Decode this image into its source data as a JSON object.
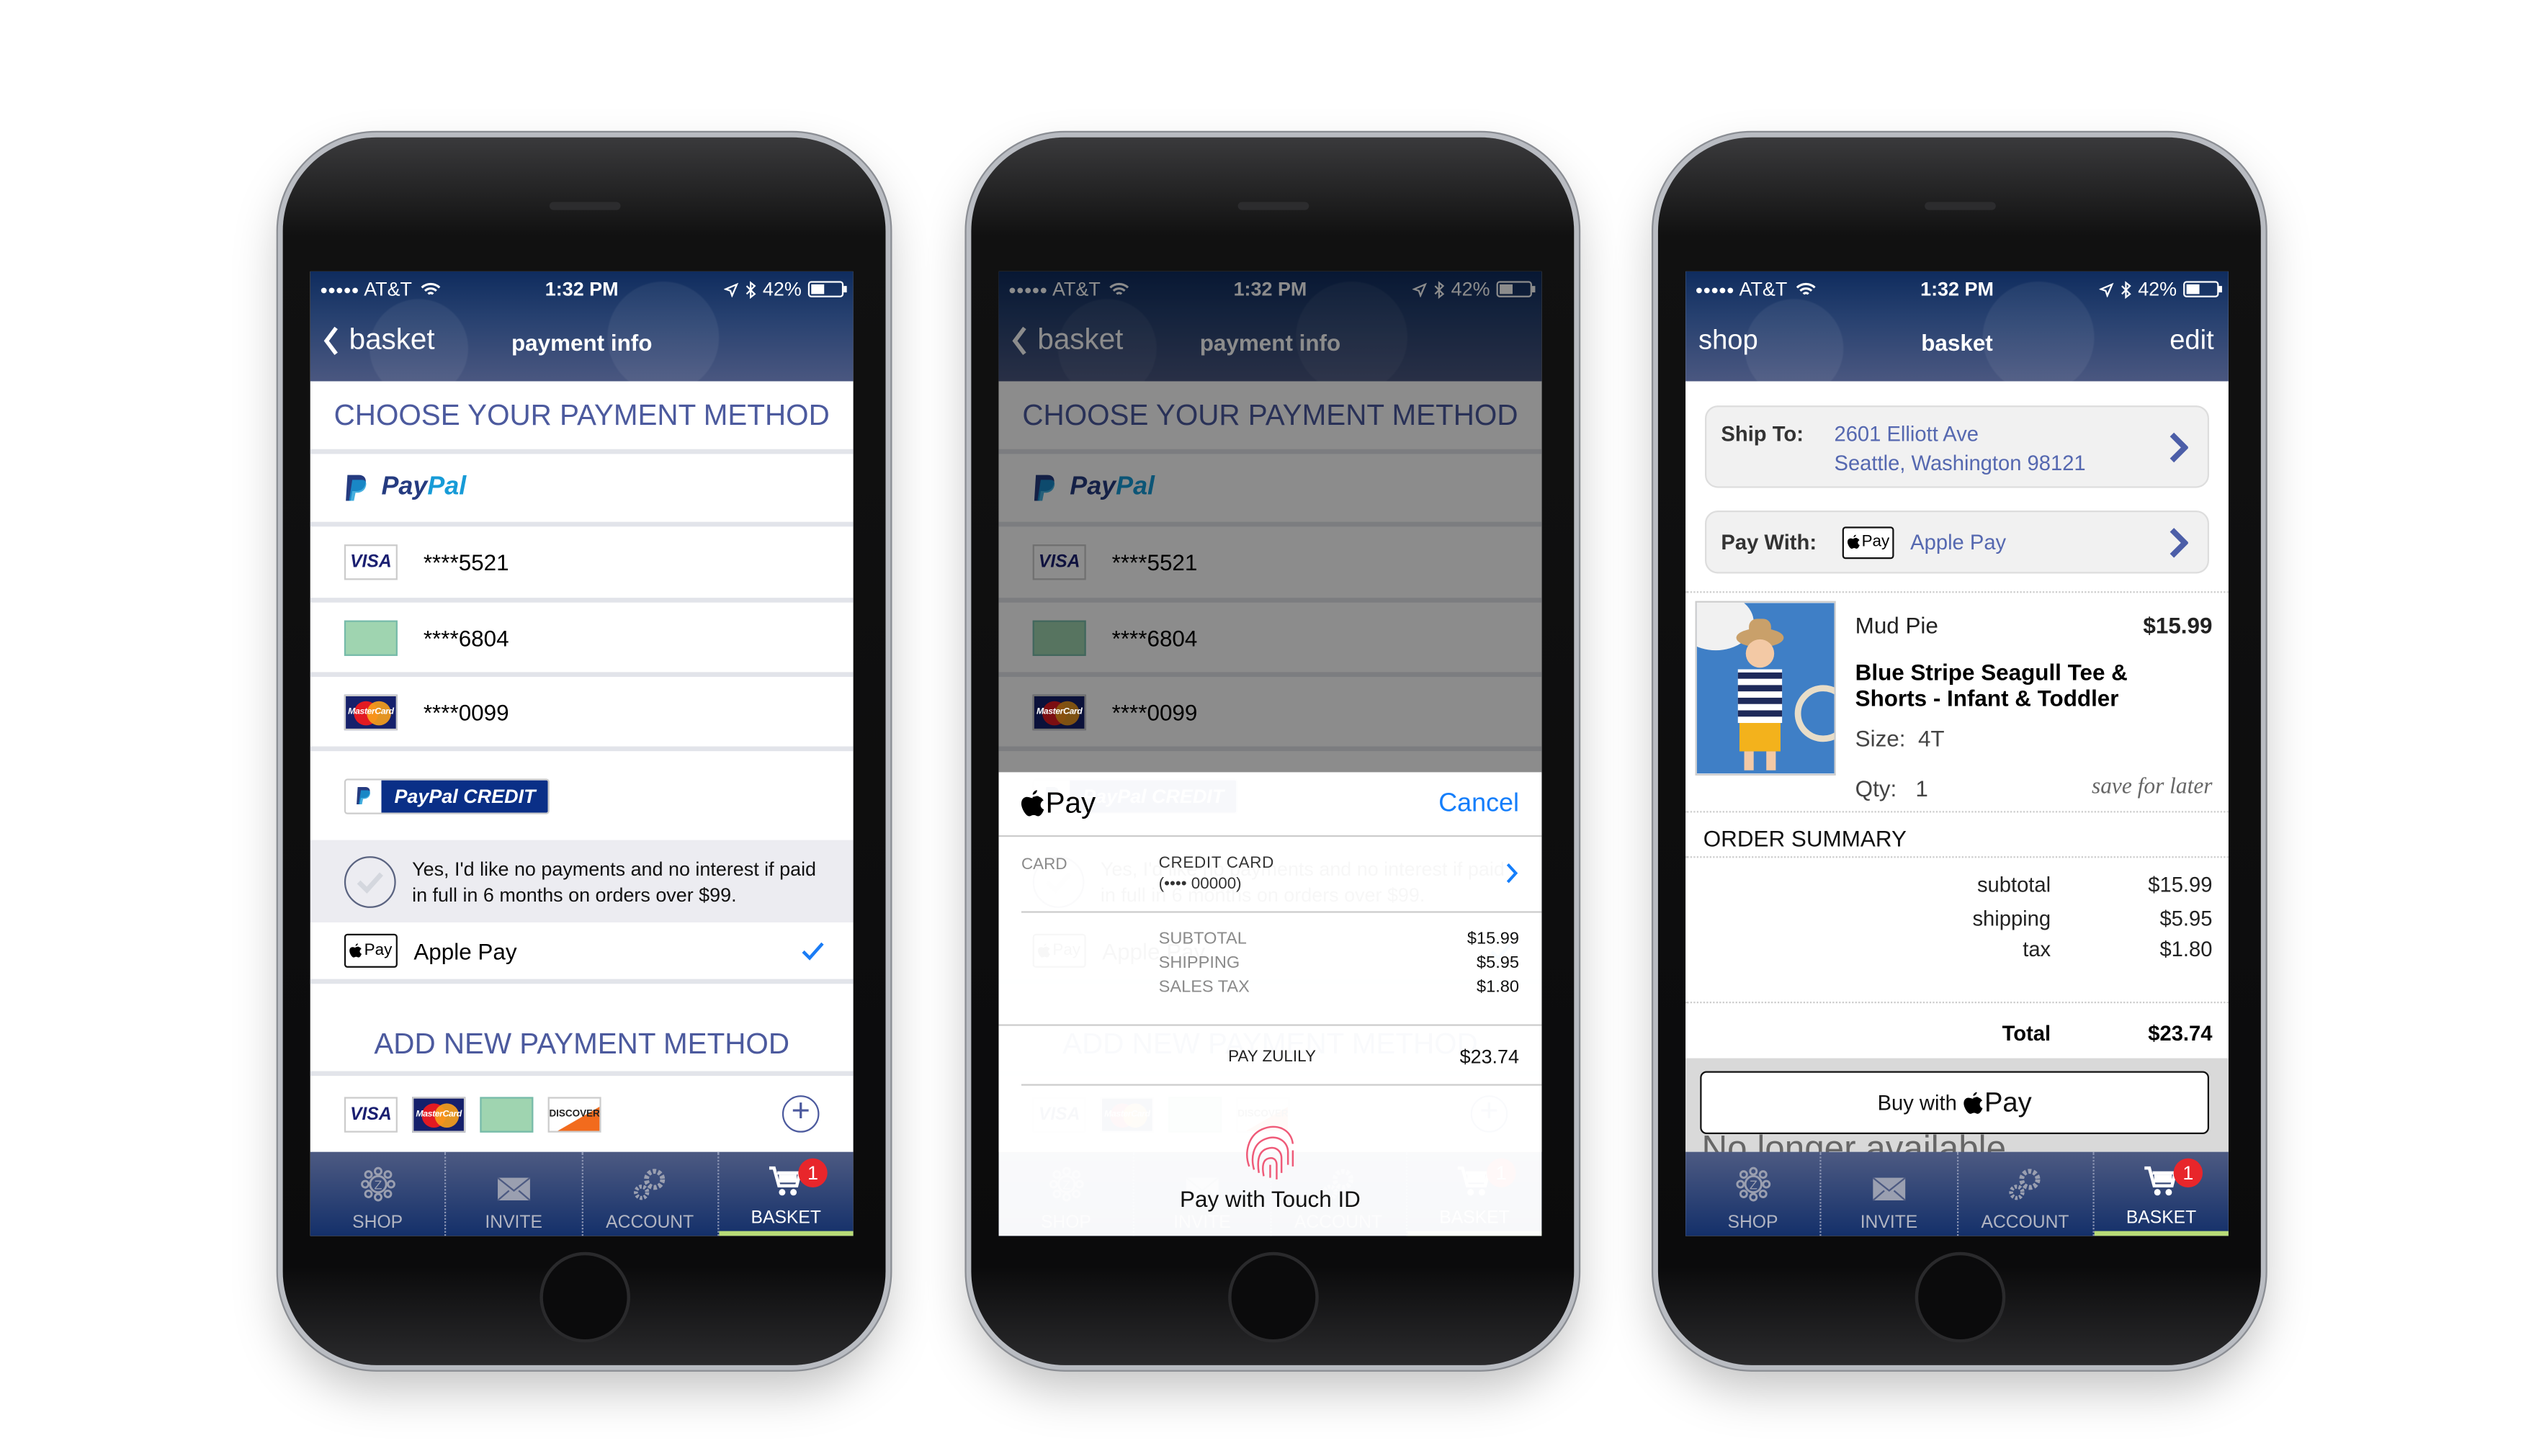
{
  "status": {
    "carrier": "AT&T",
    "time": "1:32 PM",
    "battery": "42%",
    "battery_level": 0.42
  },
  "payment_screen": {
    "nav": {
      "back": "basket",
      "title": "payment info"
    },
    "choose_title": "CHOOSE YOUR PAYMENT METHOD",
    "paypal": {
      "part1": "Pay",
      "part2": "Pal"
    },
    "cards": [
      {
        "brand": "VISA",
        "number": "****5521"
      },
      {
        "brand": "amex",
        "number": "****6804"
      },
      {
        "brand": "MasterCard",
        "number": "****0099"
      }
    ],
    "paypal_credit": "PayPal CREDIT",
    "offer_text": "Yes, I'd like no payments and no interest if paid in full in 6 months on orders over $99.",
    "apple_pay": {
      "badge": "Pay",
      "label": "Apple Pay",
      "selected": true
    },
    "add_title": "ADD NEW PAYMENT METHOD",
    "add_cards": [
      "VISA",
      "MasterCard",
      "amex",
      "DISCOVER"
    ]
  },
  "tabs": [
    {
      "label": "SHOP",
      "icon": "shop-flower-icon"
    },
    {
      "label": "INVITE",
      "icon": "envelope-icon"
    },
    {
      "label": "ACCOUNT",
      "icon": "gears-icon"
    },
    {
      "label": "BASKET",
      "icon": "cart-icon",
      "active": true,
      "badge": "1"
    }
  ],
  "apple_pay_sheet": {
    "brand": "Pay",
    "cancel": "Cancel",
    "card_label": "CARD",
    "card_name": "CREDIT CARD",
    "card_number": "(•••• 00000)",
    "lines": [
      {
        "label": "SUBTOTAL",
        "value": "$15.99"
      },
      {
        "label": "SHIPPING",
        "value": "$5.95"
      },
      {
        "label": "SALES TAX",
        "value": "$1.80"
      }
    ],
    "pay_label": "PAY ZULILY",
    "pay_total": "$23.74",
    "touch_id": "Pay with Touch ID"
  },
  "basket_screen": {
    "nav": {
      "left": "shop",
      "title": "basket",
      "right": "edit"
    },
    "ship_label": "Ship To:",
    "address_line1": "2601 Elliott Ave",
    "address_line2": "Seattle, Washington 98121",
    "pay_label": "Pay With:",
    "pay_badge": "Pay",
    "pay_value": "Apple Pay",
    "item": {
      "brand": "Mud Pie",
      "price": "$15.99",
      "name": "Blue Stripe Seagull Tee & Shorts - Infant & Toddler",
      "size_label": "Size:",
      "size": "4T",
      "qty_label": "Qty:",
      "qty": "1",
      "save_for_later": "save for later"
    },
    "summary_title": "ORDER SUMMARY",
    "lines": [
      {
        "label": "subtotal",
        "value": "$15.99"
      },
      {
        "label": "shipping",
        "value": "$5.95"
      },
      {
        "label": "tax",
        "value": "$1.80"
      }
    ],
    "total_label": "Total",
    "total": "$23.74",
    "buy_label": "Buy with",
    "buy_pay": "Pay",
    "unavailable": "No longer available"
  },
  "colors": {
    "nav_blue": "#14306a",
    "heading_blue": "#4c5a9e",
    "ios_blue": "#147efb",
    "badge_red": "#e8262b",
    "active_tab": "#b8dc78"
  }
}
